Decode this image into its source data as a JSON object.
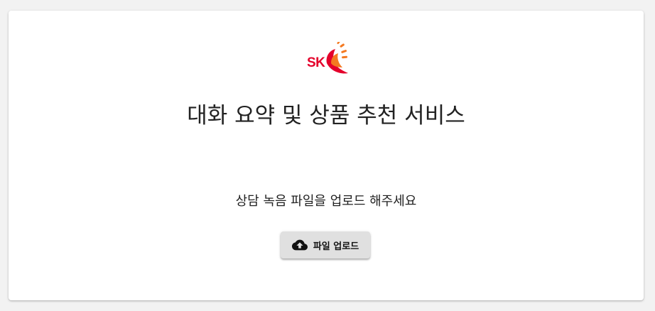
{
  "header": {
    "logo_text": "SK",
    "title": "대화 요약 및 상품 추천 서비스"
  },
  "main": {
    "instruction": "상담 녹음 파일을 업로드 해주세요",
    "upload_button_label": "파일 업로드",
    "upload_icon": "cloud-upload-icon"
  },
  "colors": {
    "brand_red": "#e4002b",
    "brand_orange": "#f47920",
    "button_bg": "#e0e0e0"
  }
}
